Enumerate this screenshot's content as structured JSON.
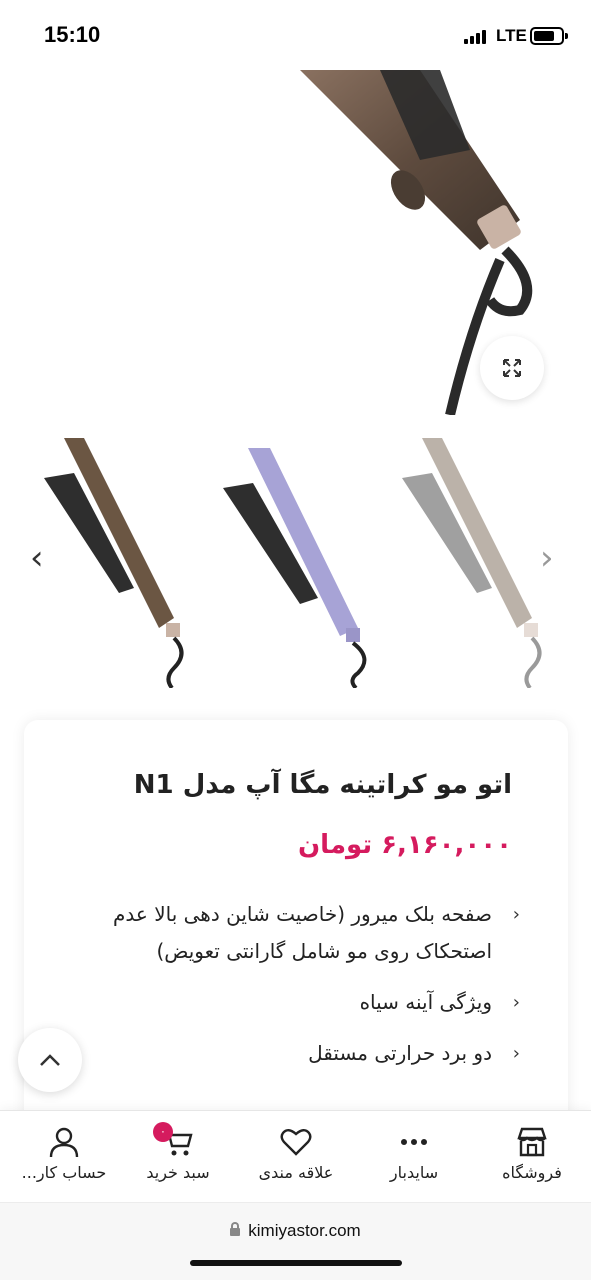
{
  "status_bar": {
    "time": "15:10",
    "network": "LTE"
  },
  "product": {
    "title": "اتو مو کراتینه مگا آپ مدل N1",
    "price": "۶,۱۶۰,۰۰۰ تومان",
    "features": [
      "صفحه بلک میرور (خاصیت شاین دهی بالا عدم اصتحکاک روی مو شامل گارانتی تعویض)",
      "ویژگی آینه سیاه",
      "دو برد حرارتی مستقل"
    ],
    "thumbnail_colors": [
      "#6b5643",
      "#a7a3d6",
      "#6b5643"
    ]
  },
  "bottom_nav": {
    "items": [
      {
        "label": "فروشگاه",
        "icon": "store-icon"
      },
      {
        "label": "سایدبار",
        "icon": "more-dots-icon"
      },
      {
        "label": "علاقه مندی",
        "icon": "heart-icon"
      },
      {
        "label": "سبد خرید",
        "icon": "cart-icon"
      },
      {
        "label": "حساب کار...",
        "icon": "user-icon"
      }
    ],
    "cart_badge": "۰"
  },
  "browser": {
    "url": "kimiyastor.com"
  },
  "colors": {
    "price": "#d51b5e",
    "badge": "#d51b5e"
  }
}
